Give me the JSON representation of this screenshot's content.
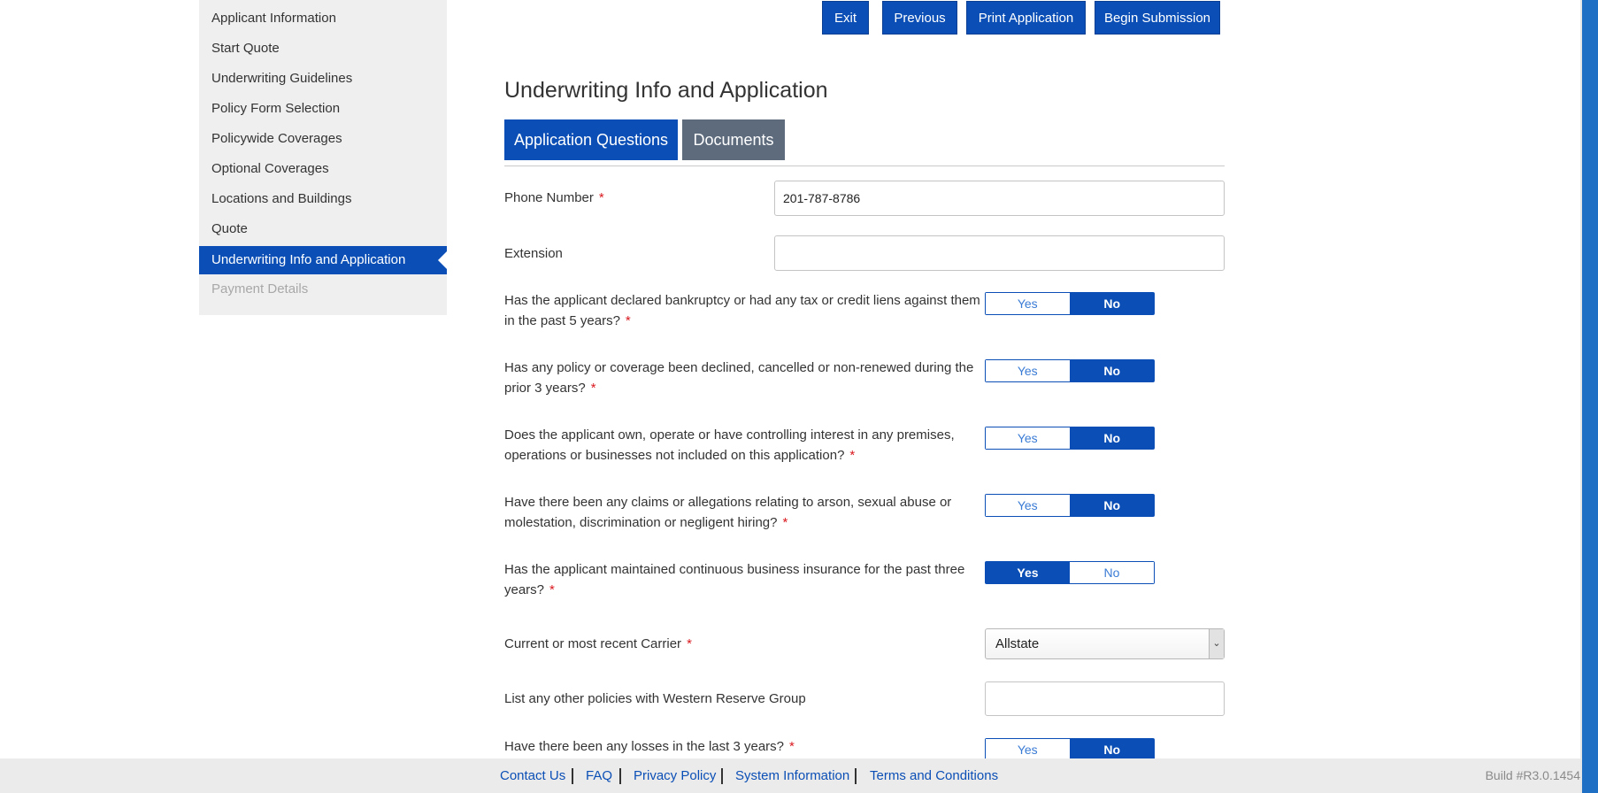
{
  "sidebar": {
    "items": [
      {
        "label": "Applicant Information"
      },
      {
        "label": "Start Quote"
      },
      {
        "label": "Underwriting Guidelines"
      },
      {
        "label": "Policy Form Selection"
      },
      {
        "label": "Policywide Coverages"
      },
      {
        "label": "Optional Coverages"
      },
      {
        "label": "Locations and Buildings"
      },
      {
        "label": "Quote"
      },
      {
        "label": "Underwriting Info and Application",
        "state": "active"
      },
      {
        "label": "Payment Details",
        "state": "disabled"
      }
    ]
  },
  "toolbar": {
    "exit_label": "Exit",
    "previous_label": "Previous",
    "print_label": "Print Application",
    "submit_label": "Begin Submission"
  },
  "page": {
    "title": "Underwriting Info and Application",
    "tabs": [
      {
        "label": "Application Questions",
        "state": "active"
      },
      {
        "label": "Documents",
        "state": "inactive"
      }
    ]
  },
  "form": {
    "required_marker": "*",
    "phone": {
      "label": "Phone Number",
      "value": "201-787-8786"
    },
    "extension": {
      "label": "Extension",
      "value": ""
    },
    "questions": [
      {
        "line1": "Has the applicant declared bankruptcy or had any tax or credit liens against them",
        "line2": "in the past 5 years?",
        "yes": "Yes",
        "no": "No",
        "selected": "No"
      },
      {
        "line1": "Has any policy or coverage been declined, cancelled or non-renewed during the",
        "line2": "prior 3 years?",
        "yes": "Yes",
        "no": "No",
        "selected": "No"
      },
      {
        "line1": "Does the applicant own, operate or have controlling interest in any premises,",
        "line2": "operations or businesses not included on this application?",
        "yes": "Yes",
        "no": "No",
        "selected": "No"
      },
      {
        "line1": "Have there been any claims or allegations relating to arson, sexual abuse or",
        "line2": "molestation, discrimination or negligent hiring?",
        "yes": "Yes",
        "no": "No",
        "selected": "No"
      },
      {
        "line1": "Has the applicant maintained continuous business insurance for the past three",
        "line2": "years?",
        "yes": "Yes",
        "no": "No",
        "selected": "Yes"
      }
    ],
    "carrier": {
      "label": "Current or most recent Carrier",
      "value": "Allstate"
    },
    "other_policies": {
      "label": "List any other policies with Western Reserve Group",
      "value": ""
    },
    "losses": {
      "label": "Have there been any losses in the last 3 years?",
      "yes": "Yes",
      "no": "No",
      "selected": "No"
    }
  },
  "footer": {
    "links": [
      "Contact Us",
      "FAQ",
      "Privacy Policy",
      "System Information",
      "Terms and Conditions"
    ],
    "build": "Build #R3.0.1454"
  },
  "colors": {
    "primary": "#0b4fb6",
    "tab_inactive": "#5d6b7d",
    "required": "#d9191f",
    "sidebar_bg": "#efefef",
    "footer_bg": "#ebebeb"
  }
}
